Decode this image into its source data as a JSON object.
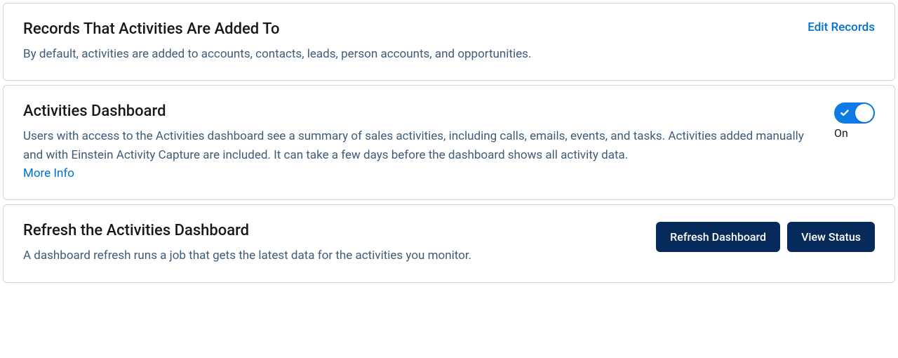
{
  "records_section": {
    "title": "Records That Activities Are Added To",
    "description": "By default, activities are added to accounts, contacts, leads, person accounts, and opportunities.",
    "edit_link": "Edit Records"
  },
  "dashboard_section": {
    "title": "Activities Dashboard",
    "description": "Users with access to the Activities dashboard see a summary of sales activities, including calls, emails, events, and tasks. Activities added manually and with Einstein Activity Capture are included. It can take a few days before the dashboard shows all activity data.",
    "more_info_link": "More Info",
    "toggle_state": "On"
  },
  "refresh_section": {
    "title": "Refresh the Activities Dashboard",
    "description": "A dashboard refresh runs a job that gets the latest data for the activities you monitor.",
    "refresh_btn": "Refresh Dashboard",
    "view_status_btn": "View Status"
  }
}
